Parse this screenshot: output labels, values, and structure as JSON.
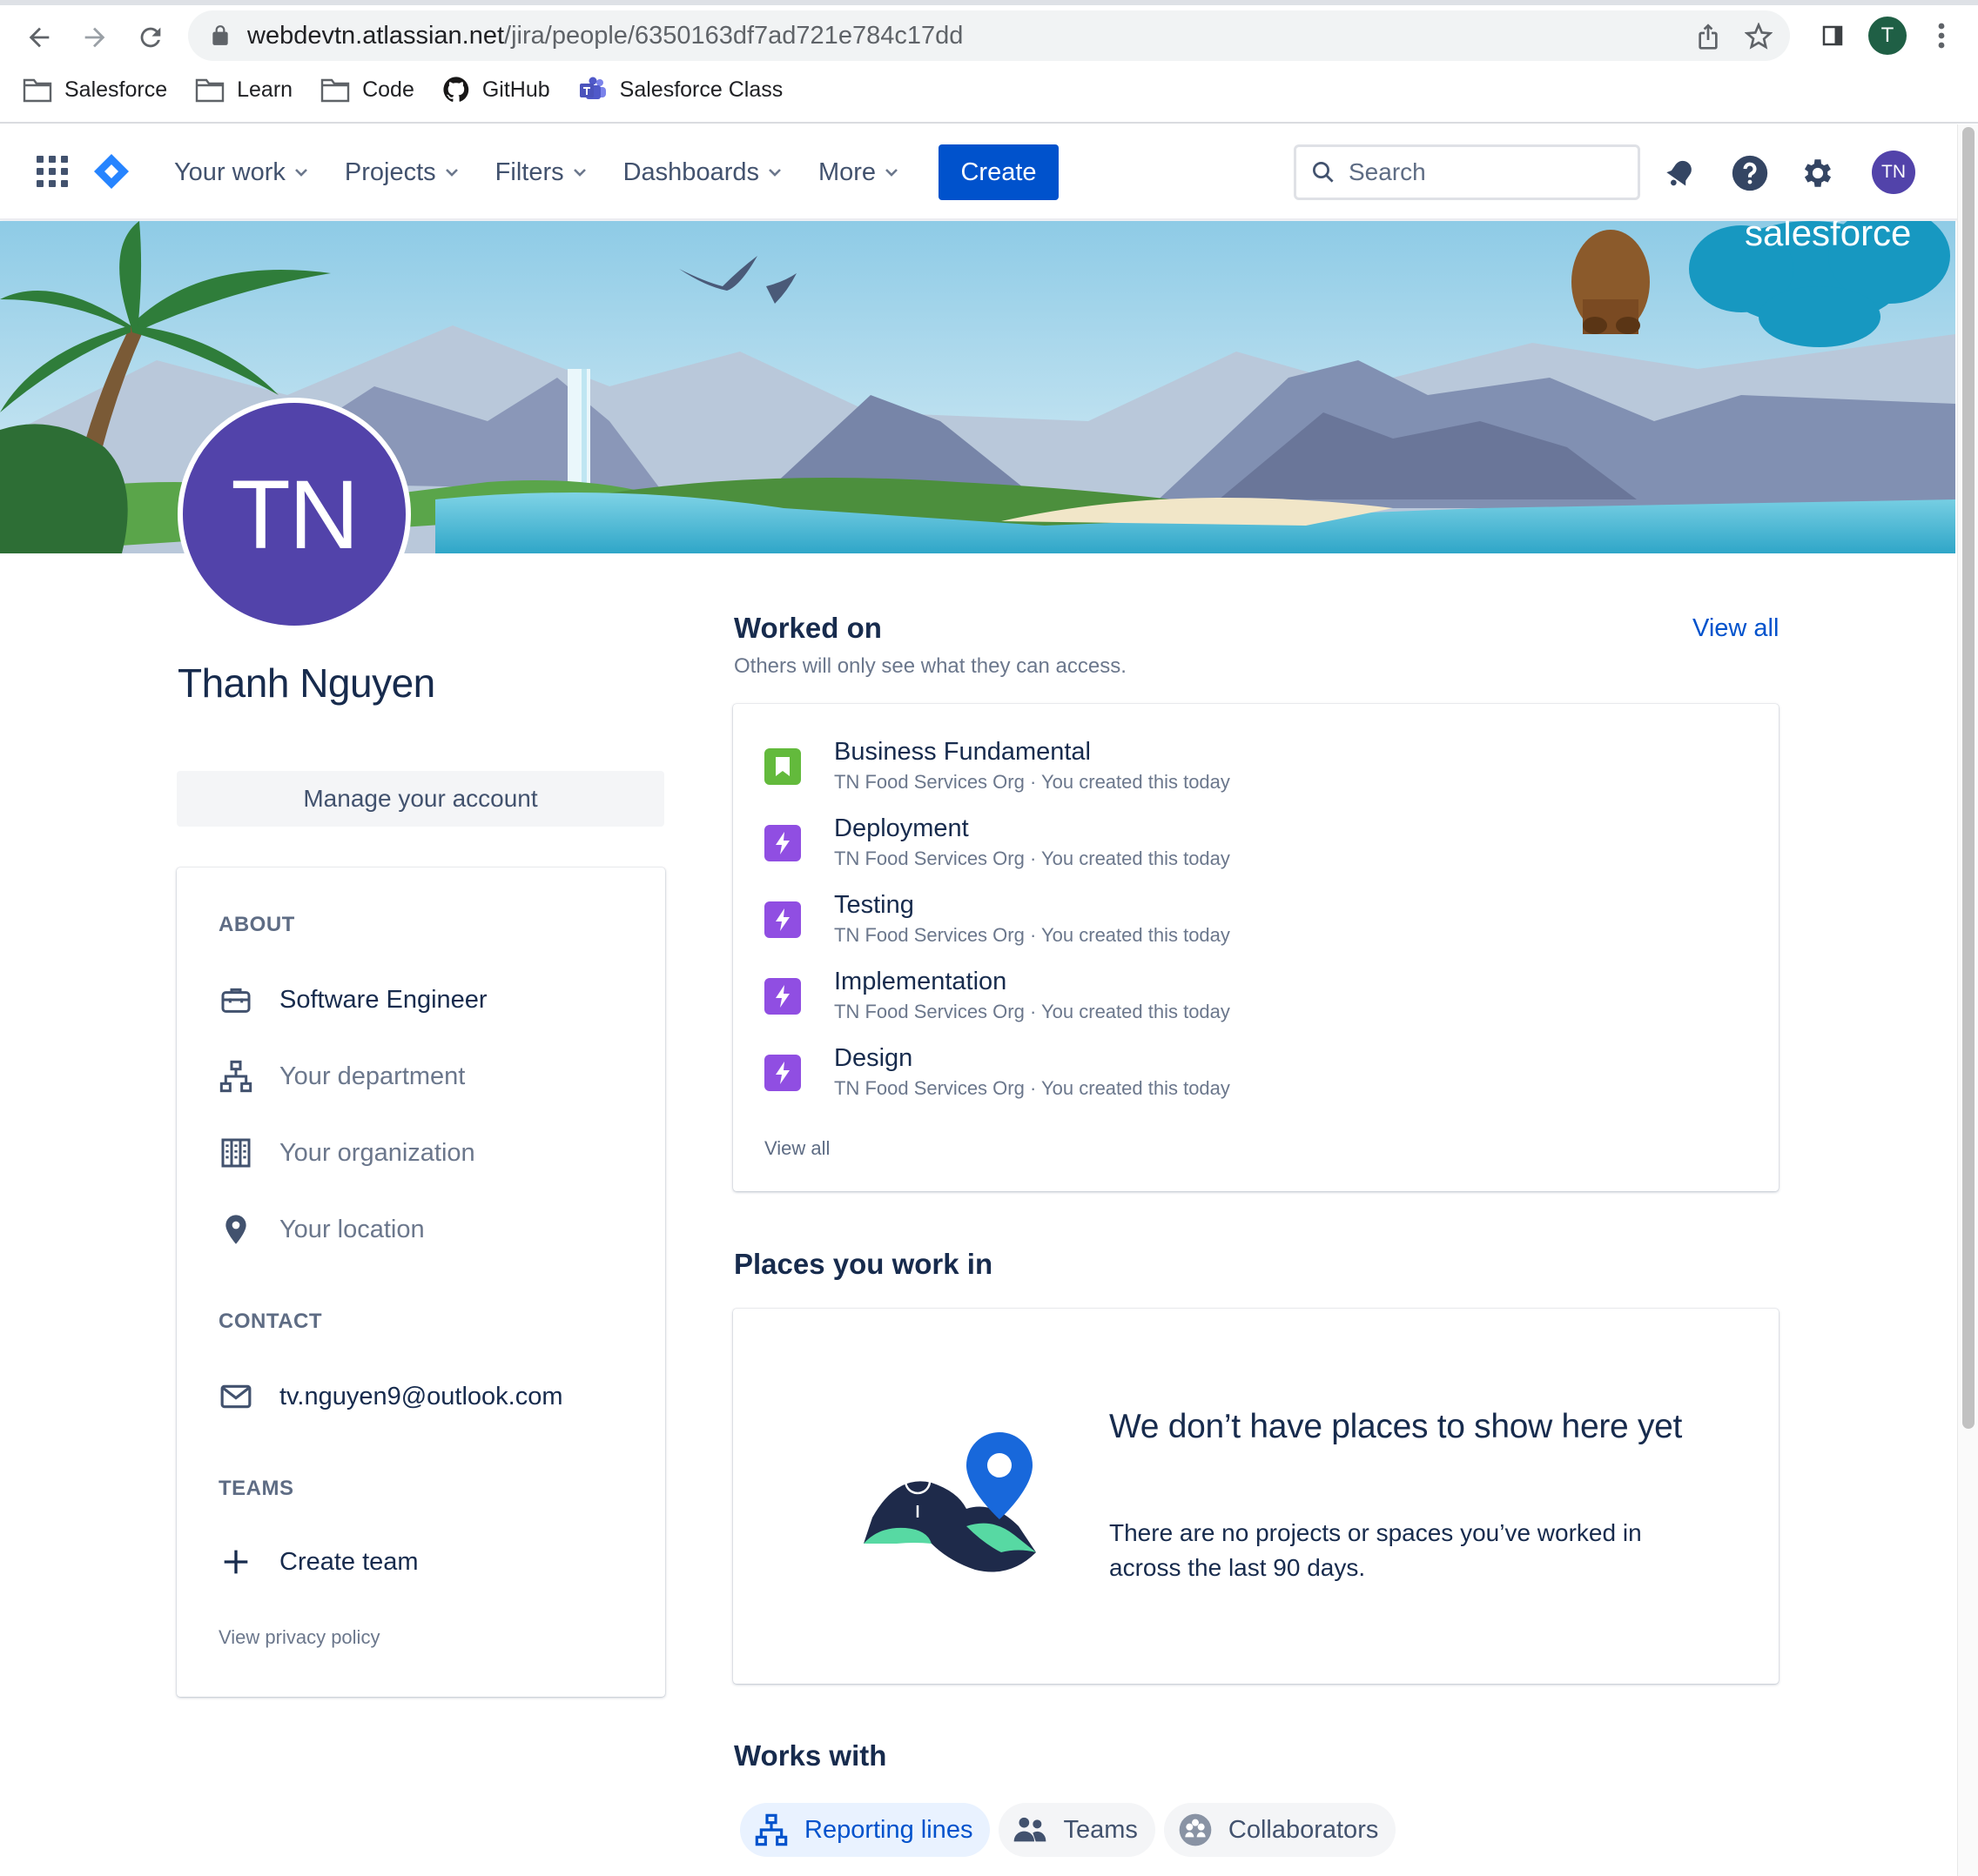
{
  "browser": {
    "url_host": "webdevtn.atlassian.net",
    "url_path": "/jira/people/6350163df7ad721e784c17dd",
    "profile_initial": "T",
    "bookmarks": [
      {
        "label": "Salesforce",
        "icon": "folder-icon"
      },
      {
        "label": "Learn",
        "icon": "folder-icon"
      },
      {
        "label": "Code",
        "icon": "folder-icon"
      },
      {
        "label": "GitHub",
        "icon": "github-icon"
      },
      {
        "label": "Salesforce Class",
        "icon": "teams-icon"
      }
    ]
  },
  "nav": {
    "items": [
      {
        "label": "Your work"
      },
      {
        "label": "Projects"
      },
      {
        "label": "Filters"
      },
      {
        "label": "Dashboards"
      },
      {
        "label": "More"
      }
    ],
    "create_label": "Create",
    "search_placeholder": "Search",
    "avatar_initials": "TN"
  },
  "banner": {
    "brand_text": "salesforce"
  },
  "profile": {
    "initials": "TN",
    "name": "Thanh Nguyen",
    "manage_label": "Manage your account",
    "about_heading": "ABOUT",
    "job_title": "Software Engineer",
    "department_placeholder": "Your department",
    "organization_placeholder": "Your organization",
    "location_placeholder": "Your location",
    "contact_heading": "CONTACT",
    "email": "tv.nguyen9@outlook.com",
    "teams_heading": "TEAMS",
    "create_team_label": "Create team",
    "privacy_label": "View privacy policy"
  },
  "worked_on": {
    "title": "Worked on",
    "subtitle": "Others will only see what they can access.",
    "view_all_label": "View all",
    "items": [
      {
        "title": "Business Fundamental",
        "org": "TN Food Services Org",
        "meta": "· You created this today",
        "icon": "story-icon",
        "color": "#63ba3c"
      },
      {
        "title": "Deployment",
        "org": "TN Food Services Org",
        "meta": "· You created this today",
        "icon": "epic-icon",
        "color": "#904ee2"
      },
      {
        "title": "Testing",
        "org": "TN Food Services Org",
        "meta": "· You created this today",
        "icon": "epic-icon",
        "color": "#904ee2"
      },
      {
        "title": "Implementation",
        "org": "TN Food Services Org",
        "meta": "· You created this today",
        "icon": "epic-icon",
        "color": "#904ee2"
      },
      {
        "title": "Design",
        "org": "TN Food Services Org",
        "meta": "· You created this today",
        "icon": "epic-icon",
        "color": "#904ee2"
      }
    ],
    "card_view_all_label": "View all"
  },
  "places": {
    "title": "Places you work in",
    "empty_title": "We don’t have places to show here yet",
    "empty_desc": "There are no projects or spaces you’ve worked in across the last 90 days."
  },
  "works_with": {
    "title": "Works with",
    "tabs": [
      {
        "label": "Reporting lines",
        "active": true
      },
      {
        "label": "Teams",
        "active": false
      },
      {
        "label": "Collaborators",
        "active": false
      }
    ]
  },
  "colors": {
    "brand_blue": "#0052cc",
    "avatar_purple": "#5243aa",
    "story_green": "#63ba3c",
    "epic_purple": "#904ee2"
  }
}
